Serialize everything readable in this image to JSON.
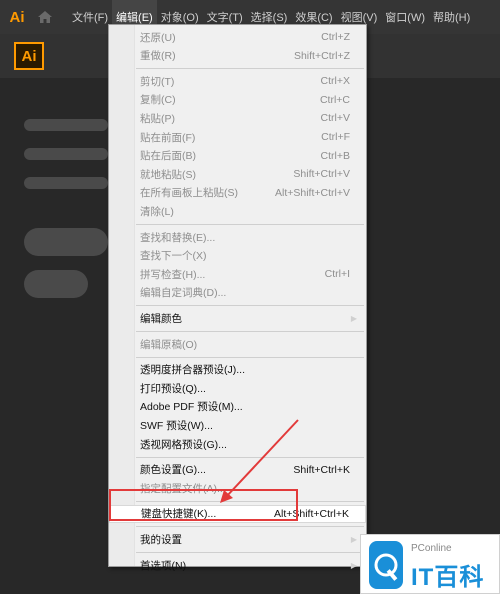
{
  "app": {
    "mark": "Ai",
    "logo_text": "Ai"
  },
  "menubar": {
    "items": [
      "文件(F)",
      "编辑(E)",
      "对象(O)",
      "文字(T)",
      "选择(S)",
      "效果(C)",
      "视图(V)",
      "窗口(W)",
      "帮助(H)"
    ],
    "active_index": 1
  },
  "edit_menu": [
    {
      "label": "还原(U)",
      "shortcut": "Ctrl+Z",
      "enabled": false
    },
    {
      "label": "重做(R)",
      "shortcut": "Shift+Ctrl+Z",
      "enabled": false
    },
    {
      "sep": true
    },
    {
      "label": "剪切(T)",
      "shortcut": "Ctrl+X",
      "enabled": false
    },
    {
      "label": "复制(C)",
      "shortcut": "Ctrl+C",
      "enabled": false
    },
    {
      "label": "粘贴(P)",
      "shortcut": "Ctrl+V",
      "enabled": false
    },
    {
      "label": "贴在前面(F)",
      "shortcut": "Ctrl+F",
      "enabled": false
    },
    {
      "label": "贴在后面(B)",
      "shortcut": "Ctrl+B",
      "enabled": false
    },
    {
      "label": "就地粘贴(S)",
      "shortcut": "Shift+Ctrl+V",
      "enabled": false
    },
    {
      "label": "在所有画板上粘贴(S)",
      "shortcut": "Alt+Shift+Ctrl+V",
      "enabled": false
    },
    {
      "label": "清除(L)",
      "shortcut": "",
      "enabled": false
    },
    {
      "sep": true
    },
    {
      "label": "查找和替换(E)...",
      "shortcut": "",
      "enabled": false
    },
    {
      "label": "查找下一个(X)",
      "shortcut": "",
      "enabled": false
    },
    {
      "label": "拼写检查(H)...",
      "shortcut": "Ctrl+I",
      "enabled": false
    },
    {
      "label": "编辑自定词典(D)...",
      "shortcut": "",
      "enabled": false
    },
    {
      "sep": true
    },
    {
      "label": "编辑颜色",
      "shortcut": "",
      "enabled": true,
      "submenu": true
    },
    {
      "sep": true
    },
    {
      "label": "编辑原稿(O)",
      "shortcut": "",
      "enabled": false
    },
    {
      "sep": true
    },
    {
      "label": "透明度拼合器预设(J)...",
      "shortcut": "",
      "enabled": true
    },
    {
      "label": "打印预设(Q)...",
      "shortcut": "",
      "enabled": true
    },
    {
      "label": "Adobe PDF 预设(M)...",
      "shortcut": "",
      "enabled": true
    },
    {
      "label": "SWF 预设(W)...",
      "shortcut": "",
      "enabled": true
    },
    {
      "label": "透视网格预设(G)...",
      "shortcut": "",
      "enabled": true
    },
    {
      "sep": true
    },
    {
      "label": "颜色设置(G)...",
      "shortcut": "Shift+Ctrl+K",
      "enabled": true
    },
    {
      "label": "指定配置文件(A)...",
      "shortcut": "",
      "enabled": false
    },
    {
      "sep": true
    },
    {
      "label": "键盘快捷键(K)...",
      "shortcut": "Alt+Shift+Ctrl+K",
      "enabled": true,
      "highlighted": true
    },
    {
      "sep": true
    },
    {
      "label": "我的设置",
      "shortcut": "",
      "enabled": true,
      "submenu": true
    },
    {
      "sep": true
    },
    {
      "label": "首选项(N)",
      "shortcut": "",
      "enabled": true,
      "submenu": true
    }
  ],
  "watermark": {
    "top": "PConline",
    "main": "IT百科"
  },
  "colors": {
    "accent": "#ff9a00",
    "callout": "#e23a3a"
  },
  "icons": {
    "home": "home-icon",
    "submenu": "triangle-right-icon"
  }
}
